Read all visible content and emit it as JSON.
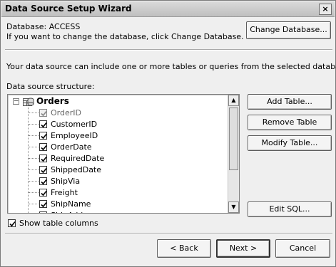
{
  "window": {
    "title": "Data Source Setup Wizard",
    "close_glyph": "×"
  },
  "database": {
    "label": "Database: ACCESS",
    "hint": "If you want to change the database, click Change Database.",
    "change_button": "Change Database..."
  },
  "intro": "Your data source can include one or more tables or queries from the selected database.",
  "structure": {
    "label": "Data source structure:",
    "root": {
      "label": "Orders",
      "expander": "−",
      "icon": "table-database-icon"
    },
    "fields": [
      {
        "label": "OrderID",
        "checked": true,
        "disabled": true
      },
      {
        "label": "CustomerID",
        "checked": true,
        "disabled": false
      },
      {
        "label": "EmployeeID",
        "checked": true,
        "disabled": false
      },
      {
        "label": "OrderDate",
        "checked": true,
        "disabled": false
      },
      {
        "label": "RequiredDate",
        "checked": true,
        "disabled": false
      },
      {
        "label": "ShippedDate",
        "checked": true,
        "disabled": false
      },
      {
        "label": "ShipVia",
        "checked": true,
        "disabled": false
      },
      {
        "label": "Freight",
        "checked": true,
        "disabled": false
      },
      {
        "label": "ShipName",
        "checked": true,
        "disabled": false
      },
      {
        "label": "ShipAddress",
        "checked": true,
        "disabled": false
      }
    ],
    "scroll_up_glyph": "▲",
    "scroll_down_glyph": "▼"
  },
  "side_buttons": {
    "add_table": "Add Table...",
    "remove_table": "Remove Table",
    "modify_table": "Modify Table...",
    "edit_sql": "Edit SQL..."
  },
  "show_columns": {
    "label": "Show table columns",
    "checked": true
  },
  "footer": {
    "back": "< Back",
    "next": "Next >",
    "cancel": "Cancel"
  }
}
